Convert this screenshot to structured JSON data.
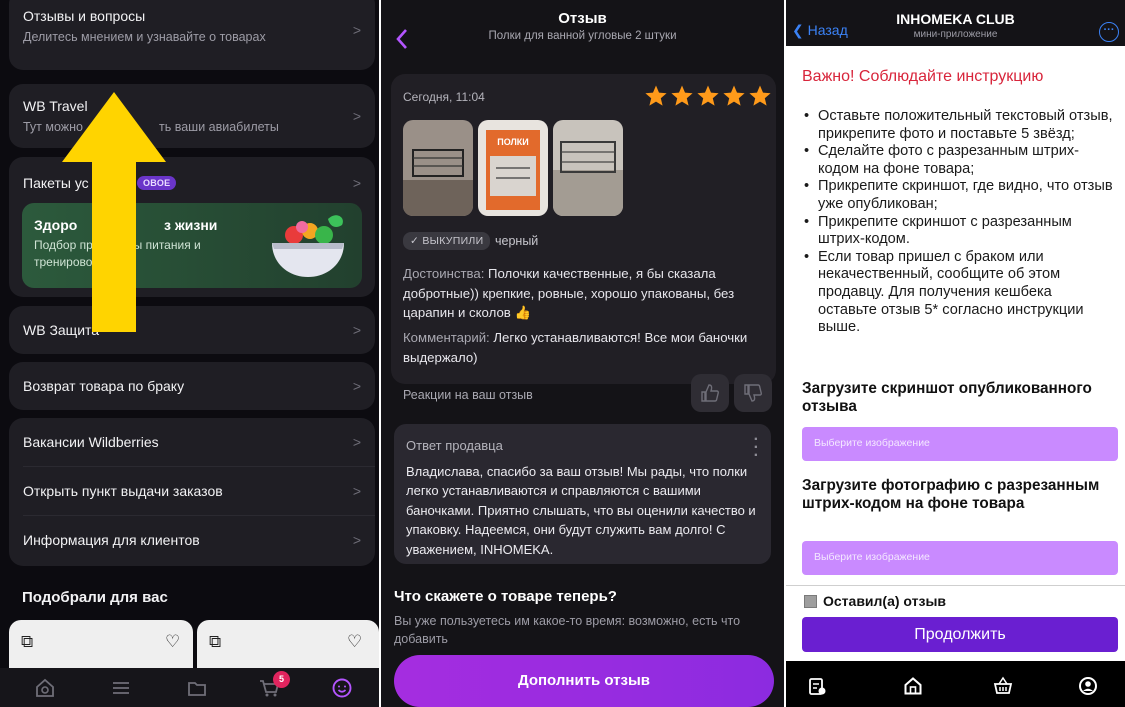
{
  "left_panel": {
    "card1": {
      "title": "Отзывы и вопросы",
      "subtitle": "Делитесь мнением и узнавайте о товарах"
    },
    "card2": {
      "title": "WB Travel",
      "subtitle_start": "Тут можно",
      "subtitle_end": "ть ваши авиабилеты"
    },
    "card3": {
      "title": "Пакеты ус",
      "badge": "ОВОЕ",
      "promo_title_start": "Здоро",
      "promo_title_end": "з жизни",
      "promo_subtitle": "Подбор программы питания и тренировок"
    },
    "card4": {
      "title": "WB Защита"
    },
    "card5": {
      "title": "Возврат товара по браку"
    },
    "card6": {
      "items": [
        "Вакансии Wildberries",
        "Открыть пункт выдачи заказов",
        "Информация для клиентов"
      ]
    },
    "section_title": "Подобрали для вас",
    "cart_badge": "5",
    "colors": {
      "bg": "#0c0b10",
      "card": "#1f1e24",
      "arrow": "#ffd400",
      "accent": "#b455ff"
    }
  },
  "review_panel": {
    "header_title": "Отзыв",
    "header_subtitle": "Полки для ванной угловые 2 штуки",
    "date": "Сегодня, 11:04",
    "rating": 5,
    "photo_label": "ПОЛКИ",
    "bought_badge": "✓ ВЫКУПИЛИ",
    "variant": "черный",
    "pros_label": "Достоинства:",
    "pros_text": " Полочки качественные, я бы сказала добротные)) крепкие, ровные, хорошо упакованы, без царапин и сколов 👍",
    "comment_label": "Комментарий:",
    "comment_text": " Легко устанавливаются! Все мои баночки выдержало)",
    "reactions_label": "Реакции на ваш отзыв",
    "seller_title": "Ответ продавца",
    "seller_text": "Владислава, спасибо за ваш отзыв! Мы рады, что полки легко устанавливаются и справляются с вашими баночками. Приятно слышать, что вы оценили качество и упаковку. Надеемся, они будут служить вам долго! С уважением, INHOMEKA.",
    "ask_title": "Что скажете о товаре теперь?",
    "ask_subtitle": "Вы уже пользуетесь им какое-то время: возможно, есть что добавить",
    "cta": "Дополнить отзыв",
    "colors": {
      "star": "#ff9a1a",
      "cta": "#a52de0"
    }
  },
  "mini_app_panel": {
    "back": "Назад",
    "title": "INHOMEKA CLUB",
    "subtitle": "мини-приложение",
    "warning": "Важно! Соблюдайте инструкцию",
    "instructions": [
      "Оставьте положительный текстовый отзыв, прикрепите фото и поставьте 5 звёзд;",
      "Сделайте фото с разрезанным штрих-кодом на фоне товара;",
      "Прикрепите скриншот, где видно, что отзыв уже опубликован;",
      "Прикрепите скриншот с разрезанным штрих-кодом.",
      "Если товар пришел с браком или некачественный, сообщите об этом продавцу. Для получения кешбека оставьте отзыв 5* согласно инструкции выше."
    ],
    "upload1_title": "Загрузите скриншот опубликованного отзыва",
    "upload1_placeholder": "Выберите изображение",
    "upload2_title": "Загрузите фотографию с разрезанным штрих-кодом на фоне товара",
    "upload2_placeholder": "Выберите изображение",
    "checkbox_label": "Оставил(а) отзыв",
    "cta": "Продолжить",
    "colors": {
      "warning": "#d8253b",
      "upload": "#c98aff",
      "cta": "#6a1fd1",
      "link": "#3b82f6"
    }
  }
}
